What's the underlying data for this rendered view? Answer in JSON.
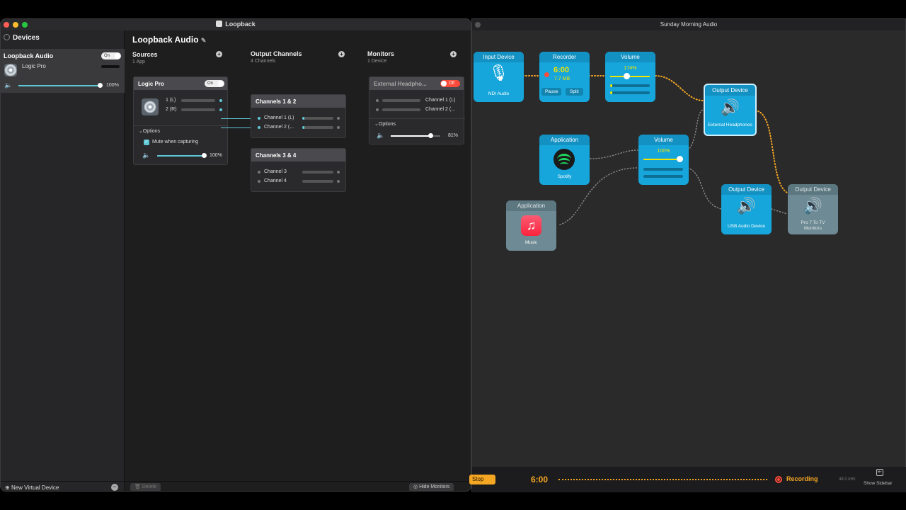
{
  "loopback": {
    "window_title": "Loopback",
    "sidebar": {
      "header": "Devices",
      "device": {
        "name": "Loopback Audio",
        "toggle": "On",
        "source": "Logic Pro",
        "volume": "100%"
      },
      "new_device_label": "New Virtual Device",
      "remove_label": "−"
    },
    "main": {
      "title": "Loopback Audio",
      "sources": {
        "label": "Sources",
        "sub": "1 App"
      },
      "outputs": {
        "label": "Output Channels",
        "sub": "4 Channels"
      },
      "monitors": {
        "label": "Monitors",
        "sub": "1 Device"
      },
      "source_card": {
        "title": "Logic Pro",
        "toggle": "On",
        "ch1": "1 (L)",
        "ch2": "2 (R)",
        "options_label": "Options",
        "mute_label": "Mute when capturing",
        "volume": "100%"
      },
      "out_card1": {
        "title": "Channels 1 & 2",
        "ch1": "Channel 1 (L)",
        "ch2": "Channel 2 (..."
      },
      "out_card2": {
        "title": "Channels 3 & 4",
        "ch1": "Channel 3",
        "ch2": "Channel 4"
      },
      "monitor_card": {
        "title": "External Headpho...",
        "toggle": "Off",
        "ch1": "Channel 1 (L)",
        "ch2": "Channel 2 (...",
        "options_label": "Options",
        "volume": "81%"
      },
      "footer": {
        "delete_label": "Delete",
        "hide_monitors_label": "Hide Monitors"
      }
    }
  },
  "hijack": {
    "window_title": "Sunday Morning Audio",
    "blocks": {
      "input": {
        "head": "Input Device",
        "caption": "NDI Audio"
      },
      "recorder": {
        "head": "Recorder",
        "time": "6:00",
        "size": "7.7 MB",
        "pause": "Pause",
        "split": "Split"
      },
      "volume1": {
        "head": "Volume",
        "value": "174%"
      },
      "out_ext": {
        "head": "Output Device",
        "caption": "External Headphones"
      },
      "app_spotify": {
        "head": "Application",
        "caption": "Spotify"
      },
      "volume2": {
        "head": "Volume",
        "value": "100%"
      },
      "app_music": {
        "head": "Application",
        "caption": "Music"
      },
      "out_usb": {
        "head": "Output Device",
        "caption": "USB Audio Device"
      },
      "out_tv": {
        "head": "Output Device",
        "caption": "Pro 7 To TV Monitors"
      }
    },
    "footer": {
      "stop_label": "Stop",
      "time": "6:00",
      "recording_label": "Recording",
      "sample_rate": "48.0 kHz",
      "show_sidebar_label": "Show Sidebar"
    }
  },
  "colors": {
    "accent_teal": "#5ec8d6",
    "block_blue": "#16a6db",
    "recording_orange": "#f5a623",
    "record_red": "#ff4b3a"
  }
}
